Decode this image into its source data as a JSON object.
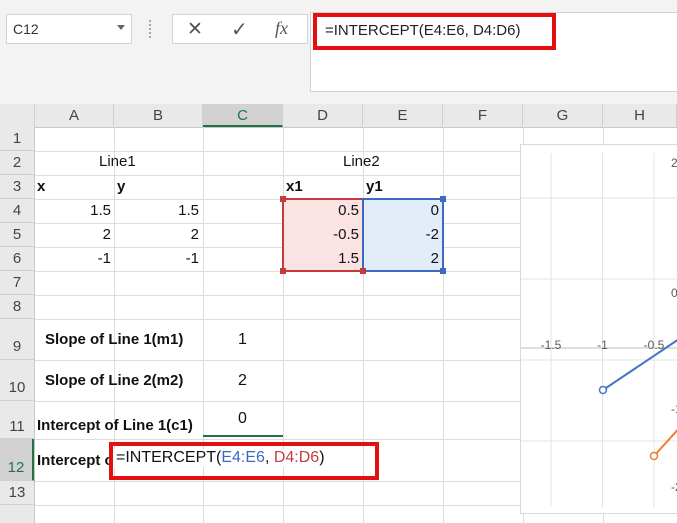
{
  "name_box": {
    "value": "C12"
  },
  "formula_bar": {
    "cancel_label": "✕",
    "enter_label": "✓",
    "fx_label": "fx",
    "formula": "=INTERCEPT(E4:E6, D4:D6)"
  },
  "columns": [
    "A",
    "B",
    "C",
    "D",
    "E",
    "F",
    "G",
    "H"
  ],
  "rows": [
    "1",
    "2",
    "3",
    "4",
    "5",
    "6",
    "7",
    "8",
    "9",
    "10",
    "11",
    "12",
    "13"
  ],
  "cells": {
    "line1_title": "Line1",
    "line2_title": "Line2",
    "x_header": "x",
    "y_header": "y",
    "x1_header": "x1",
    "y1_header": "y1",
    "a4": "1.5",
    "b4": "1.5",
    "a5": "2",
    "b5": "2",
    "a6": "-1",
    "b6": "-1",
    "d4": "0.5",
    "e4": "0",
    "d5": "-0.5",
    "e5": "-2",
    "d6": "1.5",
    "e6": "2",
    "slope1_label": "Slope of Line 1(m1)",
    "slope1_value": "1",
    "slope2_label": "Slope of Line 2(m2)",
    "slope2_value": "2",
    "intercept1_label": "Intercept of Line 1(c1)",
    "intercept1_value": "0",
    "intercept2_label": "Intercept of",
    "c12_formula_prefix": "=INTERCEPT(",
    "c12_ref1": "E4:E6",
    "c12_sep": ", ",
    "c12_ref2": "D4:D6",
    "c12_close": ")"
  },
  "chart_data": {
    "type": "scatter",
    "x_tick_labels": [
      "-1.5",
      "-1",
      "-0.5"
    ],
    "right_edge_labels": [
      "2",
      "0",
      "-1",
      "-2"
    ],
    "series": [
      {
        "color": "#4472c4",
        "points": [
          [
            -1,
            -1
          ],
          [
            0,
            0
          ]
        ]
      },
      {
        "color": "#ed7d31",
        "points": [
          [
            -0.5,
            -2
          ],
          [
            0,
            -1
          ]
        ]
      }
    ],
    "xlim": [
      -1.7,
      0.1
    ],
    "ylim": [
      -2.3,
      2.3
    ]
  },
  "colors": {
    "accent": "#217346",
    "highlight": "#e21010",
    "ref1": "#3c6ac2",
    "ref2": "#c8393d"
  }
}
